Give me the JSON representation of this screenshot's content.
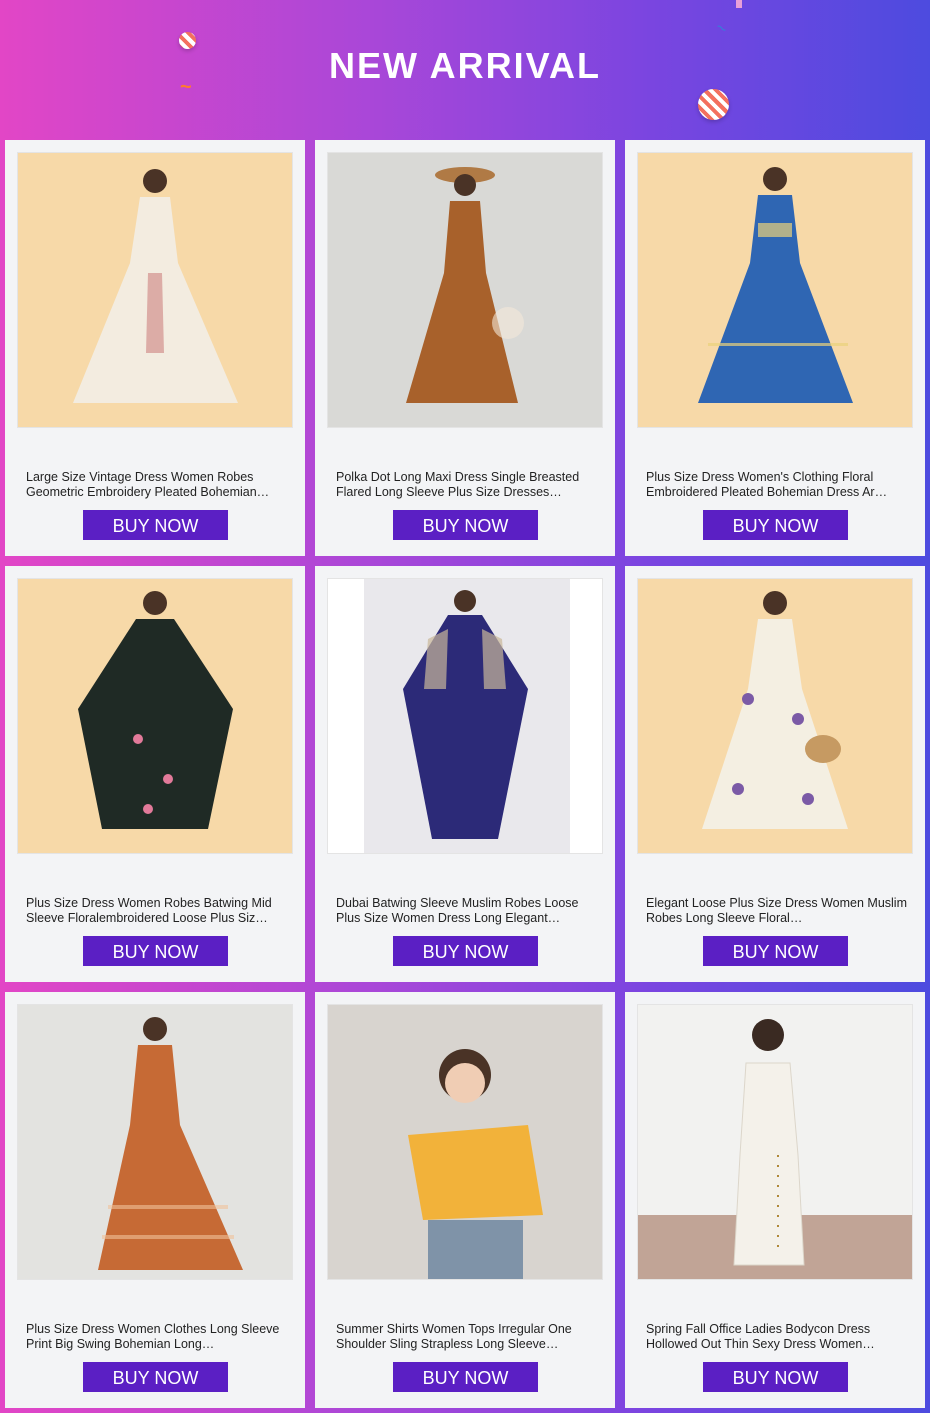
{
  "header": {
    "title": "NEW ARRIVAL"
  },
  "products": [
    {
      "name": "Large Size Vintage Dress Women Robes Geometric Embroidery Pleated Bohemian…",
      "buy_label": "BUY NOW",
      "image": {
        "background": "#f7d9a8",
        "dress": "#f3ece0",
        "accent": "#b2363a"
      }
    },
    {
      "name": "Polka Dot Long Maxi Dress Single Breasted Flared Long Sleeve Plus Size Dresses…",
      "buy_label": "BUY NOW",
      "image": {
        "background": "#d9d9d6",
        "dress": "#a8612b",
        "accent": "#f3e8d8"
      }
    },
    {
      "name": "Plus Size Dress Women's Clothing Floral Embroidered Pleated Bohemian Dress Ar…",
      "buy_label": "BUY NOW",
      "image": {
        "background": "#f7d9a8",
        "dress": "#2f66b3",
        "accent": "#e9d27a"
      }
    },
    {
      "name": "Plus Size Dress Women Robes Batwing Mid Sleeve Floralembroidered Loose Plus Siz…",
      "buy_label": "BUY NOW",
      "image": {
        "background": "#f7d9a8",
        "dress": "#1f2a25",
        "accent": "#e27a9a"
      }
    },
    {
      "name": "Dubai Batwing Sleeve Muslim Robes Loose Plus Size Women Dress Long Elegant…",
      "buy_label": "BUY NOW",
      "image": {
        "background": "#e9e8ec",
        "dress": "#2c2a78",
        "accent": "#c9b89a"
      }
    },
    {
      "name": "Elegant Loose Plus Size Dress Women Muslim Robes Long Sleeve Floral…",
      "buy_label": "BUY NOW",
      "image": {
        "background": "#f7d9a8",
        "dress": "#f4efe2",
        "accent": "#7b5aa6"
      }
    },
    {
      "name": "Plus Size Dress Women Clothes Long Sleeve Print Big Swing Bohemian Long…",
      "buy_label": "BUY NOW",
      "image": {
        "background": "#e3e3e0",
        "dress": "#c66a35",
        "accent": "#f0c29a"
      }
    },
    {
      "name": "Summer Shirts Women Tops Irregular One Shoulder Sling Strapless Long Sleeve…",
      "buy_label": "BUY NOW",
      "image": {
        "background": "#d8d4cf",
        "dress": "#f2b23a",
        "accent": "#7f93a8"
      }
    },
    {
      "name": "Spring Fall Office Ladies Bodycon Dress Hollowed Out Thin Sexy Dress Women…",
      "buy_label": "BUY NOW",
      "image": {
        "background": "#f2f2f0",
        "dress": "#f4f1ea",
        "accent": "#a0705a"
      }
    }
  ],
  "colors": {
    "button": "#5b1fc4",
    "card": "#f3f4f6",
    "gradient_left": "#e246c6",
    "gradient_right": "#4d4bdf"
  }
}
